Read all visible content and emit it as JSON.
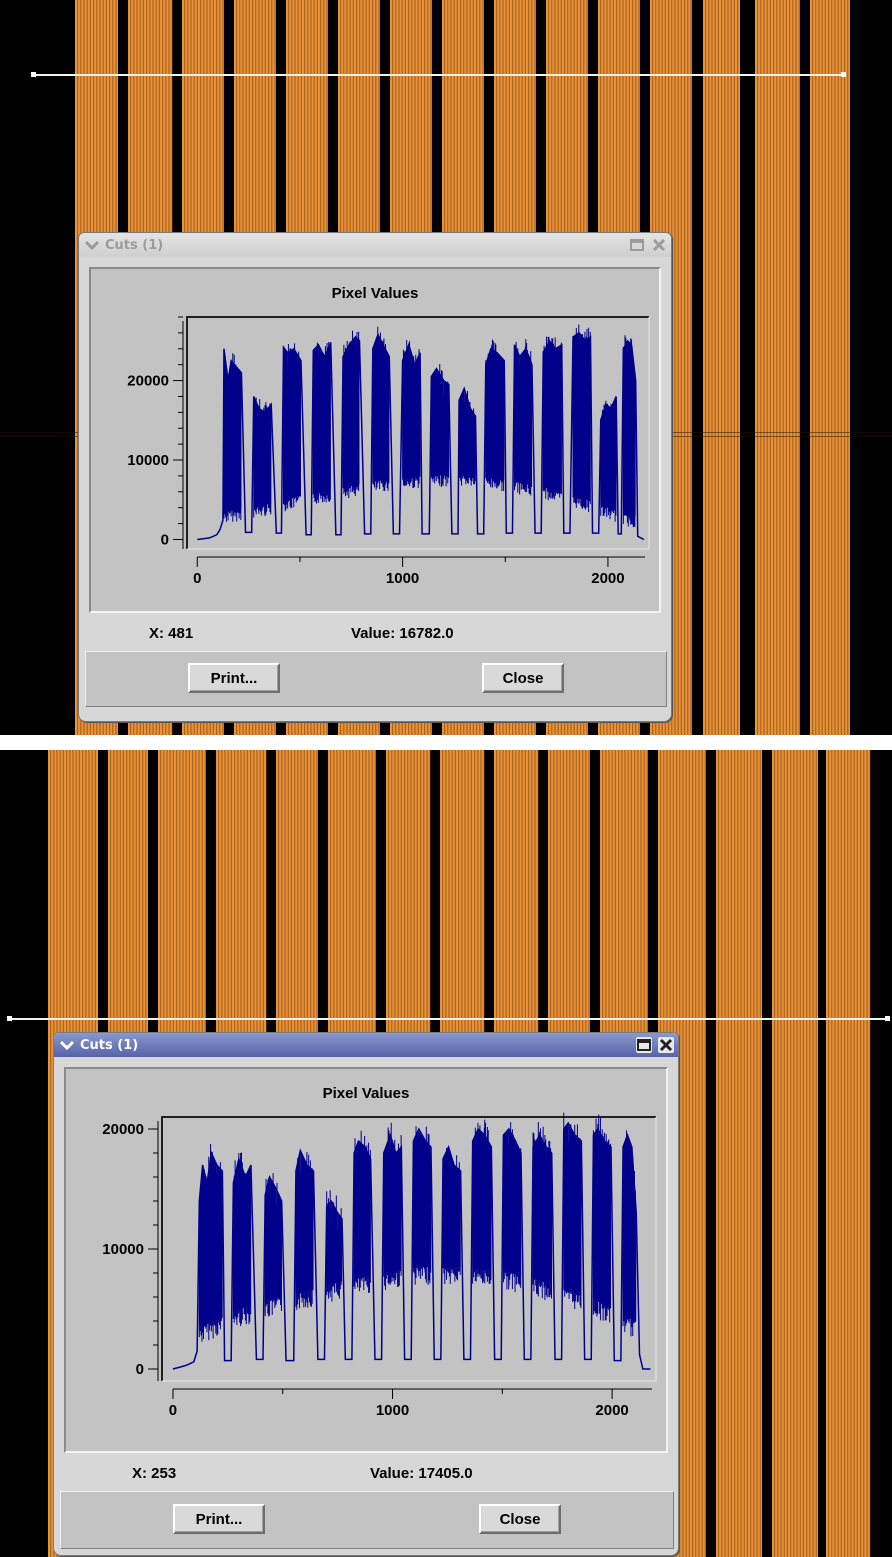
{
  "windows": [
    {
      "title": "Cuts (1)",
      "state": "inactive",
      "plot_title": "Pixel Values",
      "x_label": "X:",
      "x_value": "481",
      "value_label": "Value:",
      "value_value": "16782.0",
      "print_label": "Print...",
      "close_label": "Close",
      "icons": [
        "chevron-down-icon",
        "maximize-icon",
        "close-icon"
      ]
    },
    {
      "title": "Cuts (1)",
      "state": "active",
      "plot_title": "Pixel Values",
      "x_label": "X:",
      "x_value": "253",
      "value_label": "Value:",
      "value_value": "17405.0",
      "print_label": "Print...",
      "close_label": "Close",
      "icons": [
        "chevron-down-icon",
        "maximize-icon",
        "close-icon"
      ]
    }
  ],
  "colors": {
    "stripe_orange": "#e8923a",
    "stripe_dark": "#1a0d00",
    "plot_line": "#00008b",
    "plot_bg": "#c3c3c3",
    "title_active": "#5663a8"
  },
  "chart_data": [
    {
      "type": "line",
      "title": "Pixel Values",
      "x_ticks": [
        0,
        1000,
        2000
      ],
      "y_ticks": [
        0,
        10000,
        20000
      ],
      "xlim": [
        -50,
        2200
      ],
      "ylim": [
        -1200,
        28000
      ],
      "series": [
        {
          "points": [
            [
              0,
              0
            ],
            [
              60,
              200
            ],
            [
              95,
              600
            ],
            [
              110,
              1200
            ],
            [
              125,
              2400
            ],
            [
              130,
              24000
            ],
            [
              150,
              20000
            ],
            [
              165,
              22500
            ],
            [
              180,
              22000
            ],
            [
              215,
              21000
            ],
            [
              235,
              900
            ],
            [
              265,
              900
            ],
            [
              275,
              18000
            ],
            [
              300,
              16500
            ],
            [
              330,
              16000
            ],
            [
              360,
              17000
            ],
            [
              385,
              800
            ],
            [
              410,
              800
            ],
            [
              420,
              24200
            ],
            [
              440,
              23500
            ],
            [
              470,
              24000
            ],
            [
              505,
              22500
            ],
            [
              530,
              600
            ],
            [
              555,
              600
            ],
            [
              565,
              23800
            ],
            [
              590,
              24500
            ],
            [
              620,
              23000
            ],
            [
              650,
              24800
            ],
            [
              675,
              600
            ],
            [
              700,
              600
            ],
            [
              710,
              23000
            ],
            [
              740,
              24500
            ],
            [
              770,
              25500
            ],
            [
              790,
              25000
            ],
            [
              815,
              700
            ],
            [
              845,
              700
            ],
            [
              855,
              24000
            ],
            [
              880,
              25800
            ],
            [
              905,
              24500
            ],
            [
              935,
              23000
            ],
            [
              955,
              700
            ],
            [
              985,
              700
            ],
            [
              1000,
              22500
            ],
            [
              1030,
              24500
            ],
            [
              1060,
              22000
            ],
            [
              1085,
              23500
            ],
            [
              1095,
              700
            ],
            [
              1130,
              700
            ],
            [
              1140,
              20500
            ],
            [
              1165,
              21500
            ],
            [
              1200,
              20000
            ],
            [
              1225,
              19500
            ],
            [
              1240,
              700
            ],
            [
              1270,
              700
            ],
            [
              1275,
              17500
            ],
            [
              1300,
              19000
            ],
            [
              1330,
              16500
            ],
            [
              1355,
              15500
            ],
            [
              1365,
              700
            ],
            [
              1395,
              700
            ],
            [
              1405,
              22000
            ],
            [
              1430,
              24000
            ],
            [
              1460,
              23500
            ],
            [
              1495,
              22500
            ],
            [
              1505,
              800
            ],
            [
              1535,
              800
            ],
            [
              1545,
              24500
            ],
            [
              1570,
              23000
            ],
            [
              1600,
              24000
            ],
            [
              1630,
              22000
            ],
            [
              1645,
              800
            ],
            [
              1675,
              800
            ],
            [
              1685,
              23500
            ],
            [
              1715,
              25000
            ],
            [
              1745,
              24000
            ],
            [
              1775,
              24500
            ],
            [
              1785,
              800
            ],
            [
              1815,
              800
            ],
            [
              1830,
              25500
            ],
            [
              1860,
              26000
            ],
            [
              1890,
              25000
            ],
            [
              1915,
              25500
            ],
            [
              1925,
              800
            ],
            [
              1955,
              800
            ],
            [
              1965,
              15000
            ],
            [
              1990,
              17000
            ],
            [
              2015,
              16500
            ],
            [
              2040,
              18000
            ],
            [
              2050,
              700
            ],
            [
              2065,
              700
            ],
            [
              2075,
              24000
            ],
            [
              2095,
              25000
            ],
            [
              2115,
              24500
            ],
            [
              2135,
              20000
            ],
            [
              2145,
              400
            ],
            [
              2175,
              0
            ]
          ],
          "noise_floor": [
            [
              130,
              3500
            ],
            [
              300,
              4200
            ],
            [
              500,
              5500
            ],
            [
              700,
              6500
            ],
            [
              900,
              7500
            ],
            [
              1100,
              8000
            ],
            [
              1300,
              8200
            ],
            [
              1500,
              7500
            ],
            [
              1700,
              6500
            ],
            [
              1900,
              5000
            ],
            [
              2100,
              3000
            ]
          ]
        }
      ]
    },
    {
      "type": "line",
      "title": "Pixel Values",
      "x_ticks": [
        0,
        1000,
        2000
      ],
      "y_ticks": [
        0,
        10000,
        20000
      ],
      "xlim": [
        -50,
        2200
      ],
      "ylim": [
        -1000,
        21000
      ],
      "series": [
        {
          "points": [
            [
              0,
              0
            ],
            [
              60,
              300
            ],
            [
              95,
              600
            ],
            [
              110,
              1500
            ],
            [
              120,
              14000
            ],
            [
              135,
              17000
            ],
            [
              155,
              15500
            ],
            [
              175,
              18000
            ],
            [
              200,
              17000
            ],
            [
              225,
              16500
            ],
            [
              235,
              700
            ],
            [
              265,
              700
            ],
            [
              275,
              15500
            ],
            [
              300,
              17500
            ],
            [
              330,
              16000
            ],
            [
              355,
              17000
            ],
            [
              380,
              800
            ],
            [
              410,
              800
            ],
            [
              420,
              14500
            ],
            [
              440,
              16000
            ],
            [
              470,
              15000
            ],
            [
              495,
              14000
            ],
            [
              515,
              700
            ],
            [
              550,
              700
            ],
            [
              560,
              16500
            ],
            [
              580,
              18200
            ],
            [
              610,
              17000
            ],
            [
              640,
              16500
            ],
            [
              660,
              800
            ],
            [
              690,
              800
            ],
            [
              700,
              13500
            ],
            [
              720,
              14000
            ],
            [
              750,
              13000
            ],
            [
              770,
              12500
            ],
            [
              785,
              800
            ],
            [
              815,
              800
            ],
            [
              825,
              18000
            ],
            [
              845,
              19000
            ],
            [
              875,
              18500
            ],
            [
              900,
              17500
            ],
            [
              920,
              800
            ],
            [
              950,
              800
            ],
            [
              960,
              18000
            ],
            [
              990,
              19500
            ],
            [
              1015,
              18000
            ],
            [
              1040,
              18500
            ],
            [
              1055,
              800
            ],
            [
              1085,
              800
            ],
            [
              1095,
              19000
            ],
            [
              1120,
              20000
            ],
            [
              1150,
              19000
            ],
            [
              1175,
              18500
            ],
            [
              1190,
              800
            ],
            [
              1220,
              800
            ],
            [
              1230,
              17500
            ],
            [
              1255,
              18500
            ],
            [
              1280,
              17000
            ],
            [
              1310,
              16500
            ],
            [
              1325,
              800
            ],
            [
              1355,
              800
            ],
            [
              1365,
              19000
            ],
            [
              1390,
              20000
            ],
            [
              1420,
              19500
            ],
            [
              1450,
              18500
            ],
            [
              1465,
              800
            ],
            [
              1495,
              800
            ],
            [
              1505,
              19500
            ],
            [
              1530,
              20000
            ],
            [
              1560,
              19000
            ],
            [
              1585,
              18000
            ],
            [
              1600,
              800
            ],
            [
              1630,
              800
            ],
            [
              1640,
              18500
            ],
            [
              1670,
              19500
            ],
            [
              1700,
              18500
            ],
            [
              1725,
              18000
            ],
            [
              1740,
              800
            ],
            [
              1770,
              800
            ],
            [
              1780,
              20000
            ],
            [
              1800,
              20500
            ],
            [
              1830,
              19500
            ],
            [
              1860,
              19000
            ],
            [
              1875,
              800
            ],
            [
              1905,
              800
            ],
            [
              1915,
              19500
            ],
            [
              1935,
              20000
            ],
            [
              1965,
              19000
            ],
            [
              1995,
              18500
            ],
            [
              2010,
              700
            ],
            [
              2040,
              700
            ],
            [
              2050,
              18500
            ],
            [
              2070,
              19500
            ],
            [
              2090,
              18500
            ],
            [
              2110,
              13000
            ],
            [
              2125,
              1200
            ],
            [
              2140,
              0
            ],
            [
              2175,
              0
            ]
          ],
          "noise_floor": [
            [
              120,
              3500
            ],
            [
              300,
              5000
            ],
            [
              500,
              6000
            ],
            [
              700,
              7000
            ],
            [
              900,
              7800
            ],
            [
              1100,
              8500
            ],
            [
              1300,
              8500
            ],
            [
              1500,
              8200
            ],
            [
              1700,
              7200
            ],
            [
              1900,
              6000
            ],
            [
              2100,
              4000
            ]
          ]
        }
      ]
    }
  ]
}
